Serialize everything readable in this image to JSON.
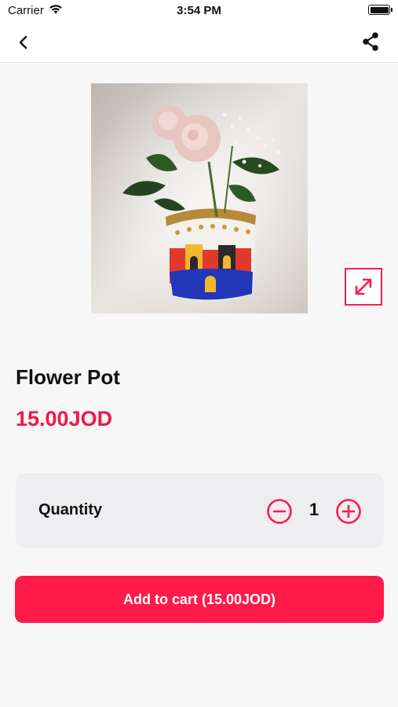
{
  "status_bar": {
    "carrier": "Carrier",
    "time": "3:54 PM",
    "wifi_icon": "wifi-icon",
    "battery_icon": "battery-icon"
  },
  "nav": {
    "back_icon": "chevron-left-icon",
    "share_icon": "share-icon"
  },
  "product": {
    "image_alt": "Flower Pot",
    "expand_icon": "expand-arrows-icon",
    "title": "Flower Pot",
    "price": "15.00JOD"
  },
  "quantity": {
    "label": "Quantity",
    "value": "1",
    "minus_icon": "minus-circle-icon",
    "plus_icon": "plus-circle-icon"
  },
  "cart": {
    "label": "Add to cart",
    "total": "(15.00JOD)"
  },
  "colors": {
    "accent": "#ff1a4a",
    "price": "#f0174a",
    "background": "#f7f7f8",
    "card": "#eeeef0"
  }
}
